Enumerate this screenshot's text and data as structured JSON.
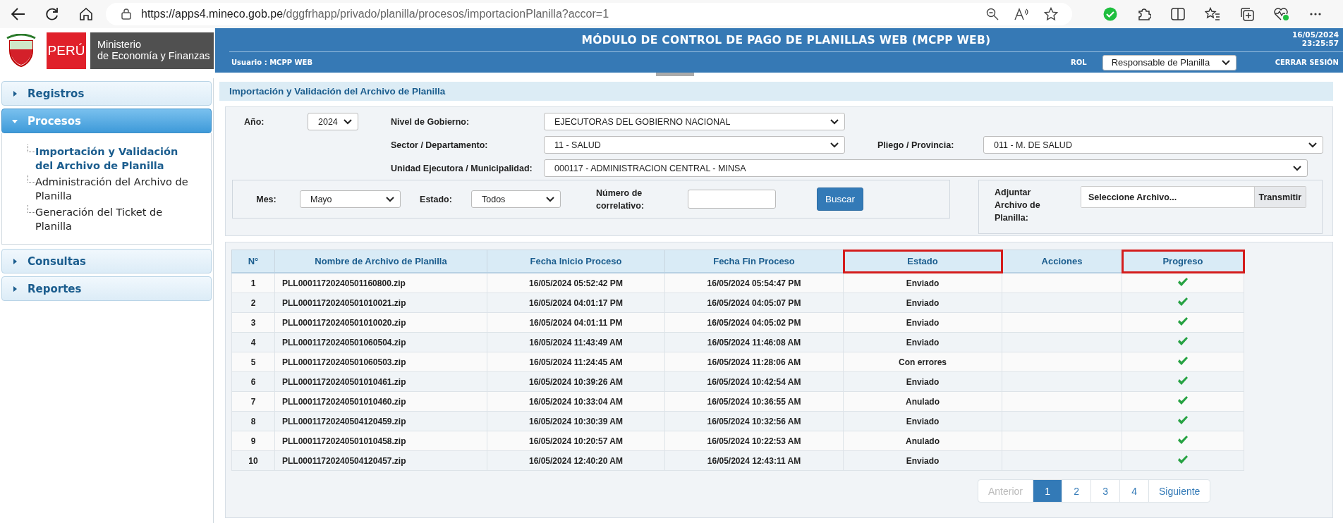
{
  "browser": {
    "url_host": "https://apps4.mineco.gob.pe",
    "url_path": "/dggfrhapp/privado/planilla/procesos/importacionPlanilla?accor=1"
  },
  "header": {
    "logo_country": "PERÚ",
    "logo_ministry_line1": "Ministerio",
    "logo_ministry_line2": "de Economía y Finanzas",
    "title": "MÓDULO DE CONTROL DE PAGO DE PLANILLAS WEB (MCPP WEB)",
    "user": "Usuario : MCPP WEB",
    "date": "16/05/2024",
    "time": "23:25:57",
    "role_label": "ROL",
    "role_value": "Responsable de Planilla",
    "logout": "CERRAR SESIÓN"
  },
  "sidebar": {
    "sections": [
      {
        "label": "Registros",
        "expanded": false
      },
      {
        "label": "Procesos",
        "expanded": true,
        "children": [
          {
            "label": "Importación y Validación del Archivo de Planilla",
            "selected": true
          },
          {
            "label": "Administración del Archivo de Planilla",
            "selected": false
          },
          {
            "label": "Generación del Ticket de Planilla",
            "selected": false
          }
        ]
      },
      {
        "label": "Consultas",
        "expanded": false
      },
      {
        "label": "Reportes",
        "expanded": false
      }
    ]
  },
  "page_title": "Importación y Validación del Archivo de Planilla",
  "filters": {
    "year": {
      "label": "Año:",
      "value": "2024"
    },
    "level": {
      "label": "Nivel de Gobierno:",
      "value": "EJECUTORAS DEL GOBIERNO NACIONAL"
    },
    "sector": {
      "label": "Sector / Departamento:",
      "value": "11 - SALUD"
    },
    "pliego": {
      "label": "Pliego / Provincia:",
      "value": "011 - M. DE SALUD"
    },
    "unit": {
      "label": "Unidad Ejecutora / Municipalidad:",
      "value": "000117 - ADMINISTRACION CENTRAL - MINSA"
    },
    "month": {
      "label": "Mes:",
      "value": "Mayo"
    },
    "status": {
      "label": "Estado:",
      "value": "Todos"
    },
    "correlative": {
      "label": "Número de correlativo:"
    },
    "search_button": "Buscar",
    "attach": {
      "label": "Adjuntar Archivo de Planilla:",
      "placeholder": "Seleccione Archivo...",
      "button": "Transmitir"
    }
  },
  "table": {
    "columns": [
      {
        "label": "N°",
        "highlighted": false
      },
      {
        "label": "Nombre de Archivo de Planilla",
        "highlighted": false
      },
      {
        "label": "Fecha Inicio Proceso",
        "highlighted": false
      },
      {
        "label": "Fecha Fin Proceso",
        "highlighted": false
      },
      {
        "label": "Estado",
        "highlighted": true
      },
      {
        "label": "Acciones",
        "highlighted": false
      },
      {
        "label": "Progreso",
        "highlighted": true
      }
    ],
    "rows": [
      {
        "n": "1",
        "file": "PLL00011720240501160800.zip",
        "start": "16/05/2024 05:52:42 PM",
        "end": "16/05/2024 05:54:47 PM",
        "status": "Enviado"
      },
      {
        "n": "2",
        "file": "PLL00011720240501010021.zip",
        "start": "16/05/2024 04:01:17 PM",
        "end": "16/05/2024 04:05:07 PM",
        "status": "Enviado"
      },
      {
        "n": "3",
        "file": "PLL00011720240501010020.zip",
        "start": "16/05/2024 04:01:11 PM",
        "end": "16/05/2024 04:05:02 PM",
        "status": "Enviado"
      },
      {
        "n": "4",
        "file": "PLL00011720240501060504.zip",
        "start": "16/05/2024 11:43:49 AM",
        "end": "16/05/2024 11:46:08 AM",
        "status": "Enviado"
      },
      {
        "n": "5",
        "file": "PLL00011720240501060503.zip",
        "start": "16/05/2024 11:24:45 AM",
        "end": "16/05/2024 11:28:06 AM",
        "status": "Con errores"
      },
      {
        "n": "6",
        "file": "PLL00011720240501010461.zip",
        "start": "16/05/2024 10:39:26 AM",
        "end": "16/05/2024 10:42:54 AM",
        "status": "Enviado"
      },
      {
        "n": "7",
        "file": "PLL00011720240501010460.zip",
        "start": "16/05/2024 10:33:04 AM",
        "end": "16/05/2024 10:36:55 AM",
        "status": "Anulado"
      },
      {
        "n": "8",
        "file": "PLL00011720240504120459.zip",
        "start": "16/05/2024 10:30:39 AM",
        "end": "16/05/2024 10:32:56 AM",
        "status": "Enviado"
      },
      {
        "n": "9",
        "file": "PLL00011720240501010458.zip",
        "start": "16/05/2024 10:20:57 AM",
        "end": "16/05/2024 10:22:53 AM",
        "status": "Anulado"
      },
      {
        "n": "10",
        "file": "PLL00011720240504120457.zip",
        "start": "16/05/2024 12:40:20 AM",
        "end": "16/05/2024 12:43:11 AM",
        "status": "Enviado"
      }
    ]
  },
  "pagination": [
    {
      "label": "Anterior",
      "selected": false,
      "disabled": true
    },
    {
      "label": "1",
      "selected": true,
      "disabled": false
    },
    {
      "label": "2",
      "selected": false,
      "disabled": false
    },
    {
      "label": "3",
      "selected": false,
      "disabled": false
    },
    {
      "label": "4",
      "selected": false,
      "disabled": false
    },
    {
      "label": "Siguiente",
      "selected": false,
      "disabled": false
    }
  ]
}
